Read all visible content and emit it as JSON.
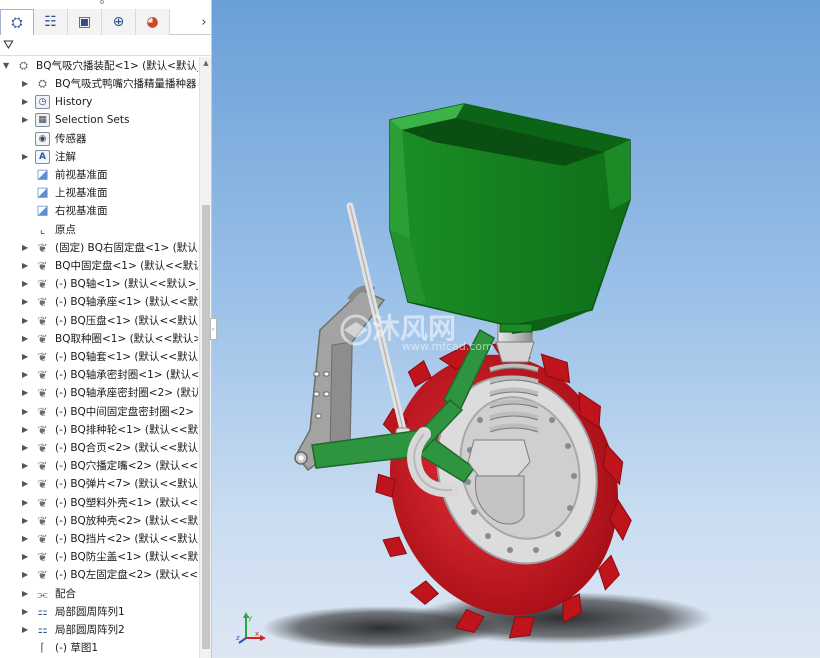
{
  "panel": {
    "tabs": [
      {
        "name": "featuremanager",
        "glyph": "⛭"
      },
      {
        "name": "propertymanager",
        "glyph": "☷"
      },
      {
        "name": "configurationmanager",
        "glyph": "▣"
      },
      {
        "name": "dimxpertmanager",
        "glyph": "⊕"
      },
      {
        "name": "displaymanager",
        "glyph": "◕"
      }
    ],
    "more_arrow": "›",
    "filter_glyph": "⛛"
  },
  "tree": {
    "root": "BQ气吸穴播装配<1> (默认<默认_显",
    "items": [
      {
        "label": "BQ气吸式鸭嘴穴播精量播种器 F",
        "icon": "folder-part-icon",
        "expand": true
      },
      {
        "label": "History",
        "icon": "history-icon",
        "expand": true
      },
      {
        "label": "Selection Sets",
        "icon": "selection-sets-icon",
        "expand": true
      },
      {
        "label": "传感器",
        "icon": "sensors-icon",
        "expand": false
      },
      {
        "label": "注解",
        "icon": "annotations-icon",
        "expand": true
      },
      {
        "label": "前视基准面",
        "icon": "plane-icon",
        "expand": false
      },
      {
        "label": "上视基准面",
        "icon": "plane-icon",
        "expand": false
      },
      {
        "label": "右视基准面",
        "icon": "plane-icon",
        "expand": false
      },
      {
        "label": "原点",
        "icon": "origin-icon",
        "expand": false
      },
      {
        "label": "(固定) BQ右固定盘<1> (默认<-",
        "icon": "part-icon",
        "expand": true
      },
      {
        "label": "BQ中固定盘<1> (默认<<默认>",
        "icon": "part-icon",
        "expand": true
      },
      {
        "label": "(-) BQ轴<1> (默认<<默认>_显",
        "icon": "part-icon",
        "expand": true
      },
      {
        "label": "(-) BQ轴承座<1> (默认<<默认>",
        "icon": "part-icon",
        "expand": true
      },
      {
        "label": "(-) BQ压盘<1> (默认<<默认>_",
        "icon": "part-icon",
        "expand": true
      },
      {
        "label": "BQ取种圈<1> (默认<<默认>_显",
        "icon": "part-icon",
        "expand": true
      },
      {
        "label": "(-) BQ轴套<1> (默认<<默认>_",
        "icon": "part-icon",
        "expand": true
      },
      {
        "label": "(-) BQ轴承密封圈<1> (默认<<",
        "icon": "part-icon",
        "expand": true
      },
      {
        "label": "(-) BQ轴承座密封圈<2> (默认<",
        "icon": "part-icon",
        "expand": true
      },
      {
        "label": "(-) BQ中间固定盘密封圈<2> (默",
        "icon": "part-icon",
        "expand": true
      },
      {
        "label": "(-) BQ排种轮<1> (默认<<默认",
        "icon": "part-icon",
        "expand": true
      },
      {
        "label": "(-) BQ合页<2> (默认<<默认>_",
        "icon": "part-icon",
        "expand": true
      },
      {
        "label": "(-) BQ穴播定嘴<2> (默认<<默",
        "icon": "part-icon",
        "expand": true
      },
      {
        "label": "(-) BQ弹片<7> (默认<<默认>_",
        "icon": "part-icon",
        "expand": true
      },
      {
        "label": "(-) BQ塑料外壳<1> (默认<<默",
        "icon": "part-icon",
        "expand": true
      },
      {
        "label": "(-) BQ放种壳<2> (默认<<默认",
        "icon": "part-icon",
        "expand": true
      },
      {
        "label": "(-) BQ挡片<2> (默认<<默认>_",
        "icon": "part-icon",
        "expand": true
      },
      {
        "label": "(-) BQ防尘盖<1> (默认<<默认",
        "icon": "part-icon",
        "expand": true
      },
      {
        "label": "(-) BQ左固定盘<2> (默认<<默",
        "icon": "part-icon",
        "expand": true
      },
      {
        "label": "配合",
        "icon": "mates-icon",
        "expand": true
      },
      {
        "label": "局部圆周阵列1",
        "icon": "circular-pattern-icon",
        "expand": true
      },
      {
        "label": "局部圆周阵列2",
        "icon": "circular-pattern-icon",
        "expand": true
      },
      {
        "label": "(-) 草图1",
        "icon": "sketch-icon",
        "expand": false
      }
    ]
  },
  "viewport": {
    "watermark_text": "沐风网",
    "watermark_url": "www.mfcad.com",
    "triad": {
      "x": "x",
      "y": "y",
      "z": "z"
    }
  },
  "colors": {
    "hopper_green": "#1f9a2a",
    "frame_green": "#2f8f3a",
    "wheel_red": "#d0161f",
    "metal_gray": "#bdbdbd",
    "bracket_gray": "#9a9a9a"
  }
}
